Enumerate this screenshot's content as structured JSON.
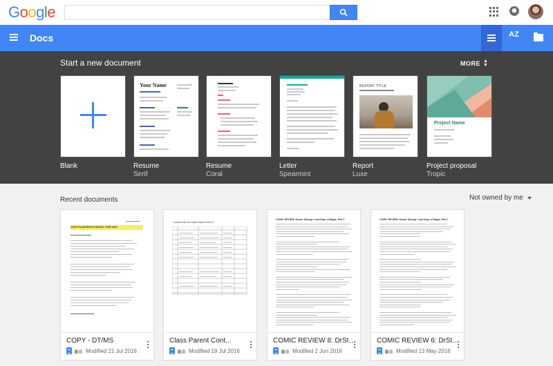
{
  "google_bar": {
    "logo_letters": [
      {
        "ch": "G",
        "color": "#4285f4"
      },
      {
        "ch": "o",
        "color": "#ea4335"
      },
      {
        "ch": "o",
        "color": "#fbbc05"
      },
      {
        "ch": "g",
        "color": "#4285f4"
      },
      {
        "ch": "l",
        "color": "#34a853"
      },
      {
        "ch": "e",
        "color": "#ea4335"
      }
    ],
    "search_value": "",
    "search_icon": "search-icon",
    "apps_icon": "apps-grid-icon",
    "notifications_icon": "notifications-icon"
  },
  "appbar": {
    "menu_icon": "hamburger-menu-icon",
    "title": "Docs",
    "list_view_icon": "list-view-icon",
    "sort_label": "AZ",
    "folder_icon": "folder-icon",
    "color": "#4285f4"
  },
  "templates": {
    "heading": "Start a new document",
    "more_label": "MORE",
    "items": [
      {
        "name": "Blank",
        "subtitle": ""
      },
      {
        "name": "Resume",
        "subtitle": "Serif"
      },
      {
        "name": "Resume",
        "subtitle": "Coral"
      },
      {
        "name": "Letter",
        "subtitle": "Spearmint"
      },
      {
        "name": "Report",
        "subtitle": "Luxe"
      },
      {
        "name": "Project proposal",
        "subtitle": "Tropic"
      }
    ],
    "thumb_text": {
      "serif_name": "Your Name",
      "luxe_title": "REPORT TITLE",
      "tropic_title": "Project Name"
    }
  },
  "recent": {
    "heading": "Recent documents",
    "owner_filter": "Not owned by me",
    "docs": [
      {
        "title": "COPY - DT/MS",
        "modified": "Modified 21 Jul 2016",
        "preview_title": "COPY/CONTENTS READY FOR ART"
      },
      {
        "title": "Class Parent Cont...",
        "modified": "Modified 19 Jul 2016",
        "preview_title": "Contact Info for Class Parent 2016-17"
      },
      {
        "title": "COMIC REVIEW 8: DrStra...",
        "modified": "Modified 2 Jun 2016",
        "preview_title": "COMIC REVIEW: Doctor Strange: Last Days of Magic, Part 2"
      },
      {
        "title": "COMIC REVIEW 6: DrStra...",
        "modified": "Modified 13 May 2016",
        "preview_title": "COMIC REVIEW: Doctor Strange: Last Days of Magic, Part 1"
      }
    ]
  }
}
